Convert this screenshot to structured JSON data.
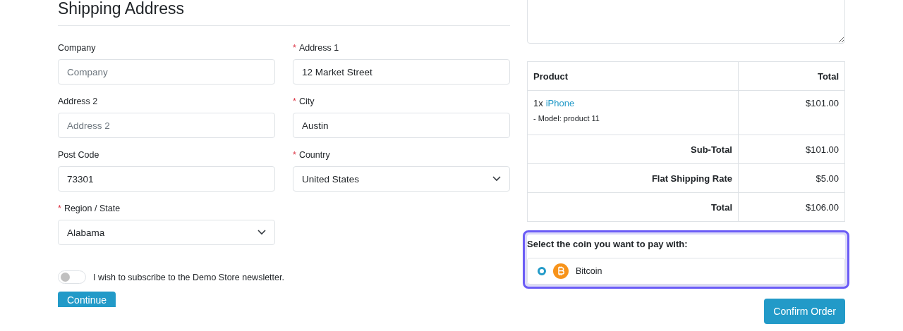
{
  "heading": "Shipping Address",
  "fields": [
    {
      "kind": "text",
      "label": "Company",
      "placeholder": "Company"
    },
    {
      "kind": "text",
      "label": "Address 1",
      "required_mark": "*",
      "value": "12 Market Street"
    },
    {
      "kind": "text",
      "label": "Address 2",
      "placeholder": "Address 2"
    },
    {
      "kind": "text",
      "label": "City",
      "required_mark": "*",
      "value": "Austin"
    },
    {
      "kind": "text",
      "label": "Post Code",
      "value": "73301"
    },
    {
      "kind": "select",
      "label": "Country",
      "required_mark": "*",
      "value": "United States"
    },
    {
      "kind": "select",
      "label": "Region / State",
      "required_mark": "*",
      "value": "Alabama"
    }
  ],
  "newsletter": {
    "label": "I wish to subscribe to the Demo Store newsletter.",
    "on": false
  },
  "continue_button": "Continue",
  "order_table": {
    "columns": [
      "Product",
      "Total"
    ],
    "items": [
      {
        "quantity": "1x",
        "name": "iPhone",
        "option": "- Model: product 11",
        "total": "$101.00"
      }
    ],
    "totals": [
      {
        "label": "Sub-Total",
        "value": "$101.00"
      },
      {
        "label": "Flat Shipping Rate",
        "value": "$5.00"
      },
      {
        "label": "Total",
        "value": "$106.00"
      }
    ]
  },
  "payment": {
    "prompt": "Select the coin you want to pay with:",
    "focused": true,
    "coins": [
      {
        "name": "Bitcoin",
        "selected": true
      }
    ]
  },
  "confirm_button": "Confirm Order"
}
